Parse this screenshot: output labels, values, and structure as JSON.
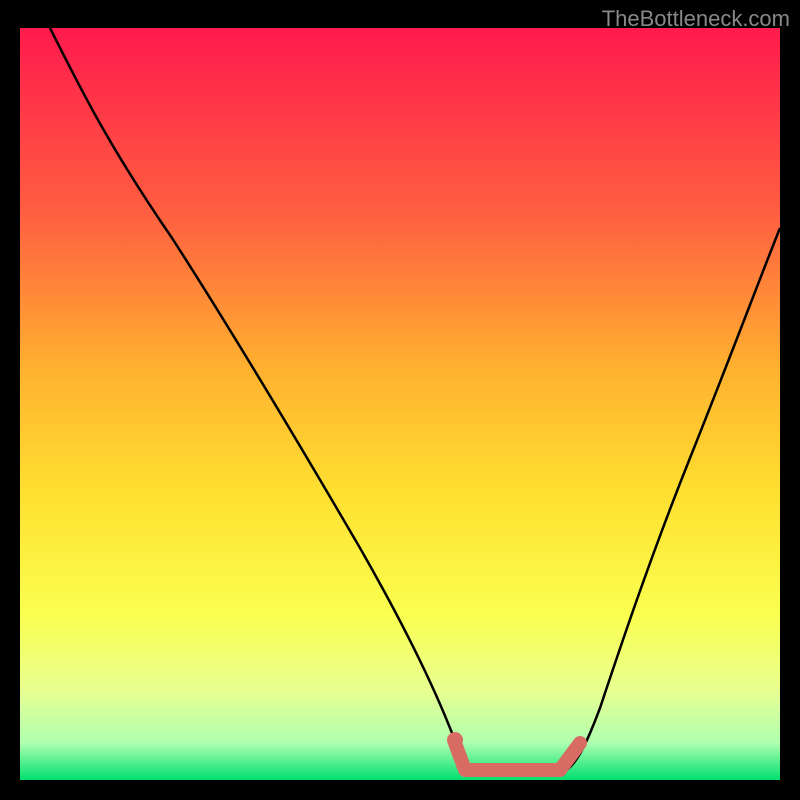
{
  "watermark": "TheBottleneck.com",
  "chart_data": {
    "type": "line",
    "title": "",
    "xlabel": "",
    "ylabel": "",
    "xlim": [
      0,
      100
    ],
    "ylim": [
      0,
      100
    ],
    "background_gradient": {
      "top": "#ff1a4d",
      "mid_upper": "#ff8040",
      "mid": "#ffe030",
      "mid_lower": "#f8ff60",
      "lower": "#d0ffa0",
      "bottom": "#00e070"
    },
    "series": [
      {
        "name": "bottleneck-curve",
        "type": "line",
        "x": [
          4,
          10,
          20,
          30,
          40,
          50,
          56,
          60,
          64,
          70,
          74,
          80,
          88,
          98
        ],
        "y": [
          100,
          90,
          72,
          54,
          36,
          18,
          6,
          2,
          2,
          2,
          6,
          20,
          44,
          80
        ],
        "stroke": "#000000",
        "stroke_width": 2
      },
      {
        "name": "optimal-range",
        "type": "line",
        "x": [
          56,
          58,
          66,
          72,
          74
        ],
        "y": [
          5,
          2,
          2,
          2,
          6
        ],
        "stroke": "#d86b64",
        "stroke_width": 8,
        "markers": true
      }
    ]
  }
}
